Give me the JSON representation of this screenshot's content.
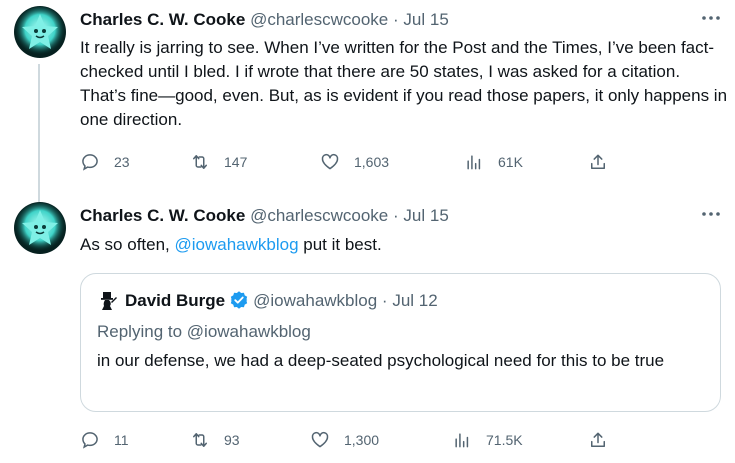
{
  "tweets": [
    {
      "author_name": "Charles C. W. Cooke",
      "handle": "@charlescwcooke",
      "separator": "·",
      "date": "Jul 15",
      "more_icon": "more-horizontal-icon",
      "text": "It really is jarring to see. When I’ve written for the Post and the Times, I’ve been fact-checked until I bled. I if wrote that there are 50 states, I was asked for a citation. That’s fine—good, even. But, as is evident if you read those papers, it only happens in one direction.",
      "stats": {
        "replies": "23",
        "reposts": "147",
        "likes": "1,603",
        "views": "61K"
      }
    },
    {
      "author_name": "Charles C. W. Cooke",
      "handle": "@charlescwcooke",
      "separator": "·",
      "date": "Jul 15",
      "text_before": "As so often, ",
      "mention": "@iowahawkblog",
      "text_after": " put it best.",
      "quote": {
        "author_name": "David Burge",
        "handle": "@iowahawkblog",
        "separator": "·",
        "date": "Jul 12",
        "replying_to_label": "Replying to ",
        "replying_to_handle": "@iowahawkblog",
        "text": "in our defense, we had a deep-seated psychological need for this to be true"
      },
      "stats": {
        "replies": "11",
        "reposts": "93",
        "likes": "1,300",
        "views": "71.5K"
      }
    }
  ],
  "colors": {
    "accent": "#1d9bf0",
    "secondary_text": "#536471",
    "border": "#cfd9de",
    "avatar_glow": "#3fd3c8"
  }
}
